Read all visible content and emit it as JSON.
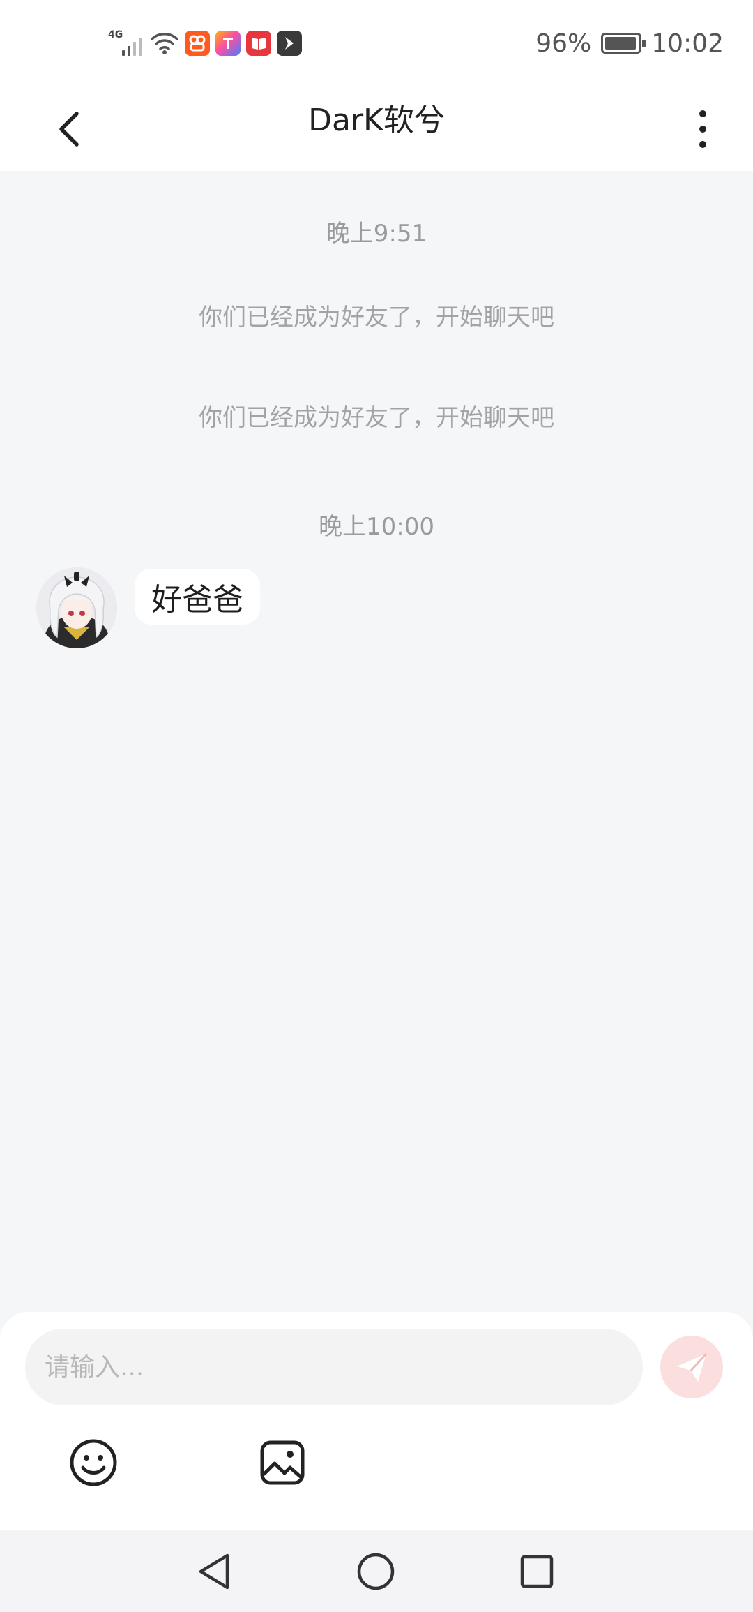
{
  "status_bar": {
    "network": "4G",
    "battery_percent_label": "96%",
    "battery_level": 0.96,
    "time": "10:02",
    "notification_icons": [
      "signal-icon",
      "wifi-icon",
      "orange-app-icon",
      "gradient-app-icon",
      "red-book-app-icon",
      "dark-arrow-app-icon"
    ]
  },
  "header": {
    "title": "DarK软兮",
    "back_icon": "chevron-left-icon",
    "more_icon": "more-vertical-icon"
  },
  "chat": {
    "timestamps": [
      "晚上9:51",
      "晚上10:00"
    ],
    "system_messages": [
      "你们已经成为好友了，开始聊天吧",
      "你们已经成为好友了，开始聊天吧"
    ],
    "messages": [
      {
        "sender": "other",
        "text": "好爸爸"
      }
    ]
  },
  "composer": {
    "placeholder": "请输入...",
    "value": "",
    "send_icon": "paper-plane-icon",
    "tools": [
      "emoji-icon",
      "image-icon"
    ],
    "accent_color": "#f5a0a0"
  },
  "system_nav": [
    "back-triangle-icon",
    "home-circle-icon",
    "recents-square-icon"
  ]
}
